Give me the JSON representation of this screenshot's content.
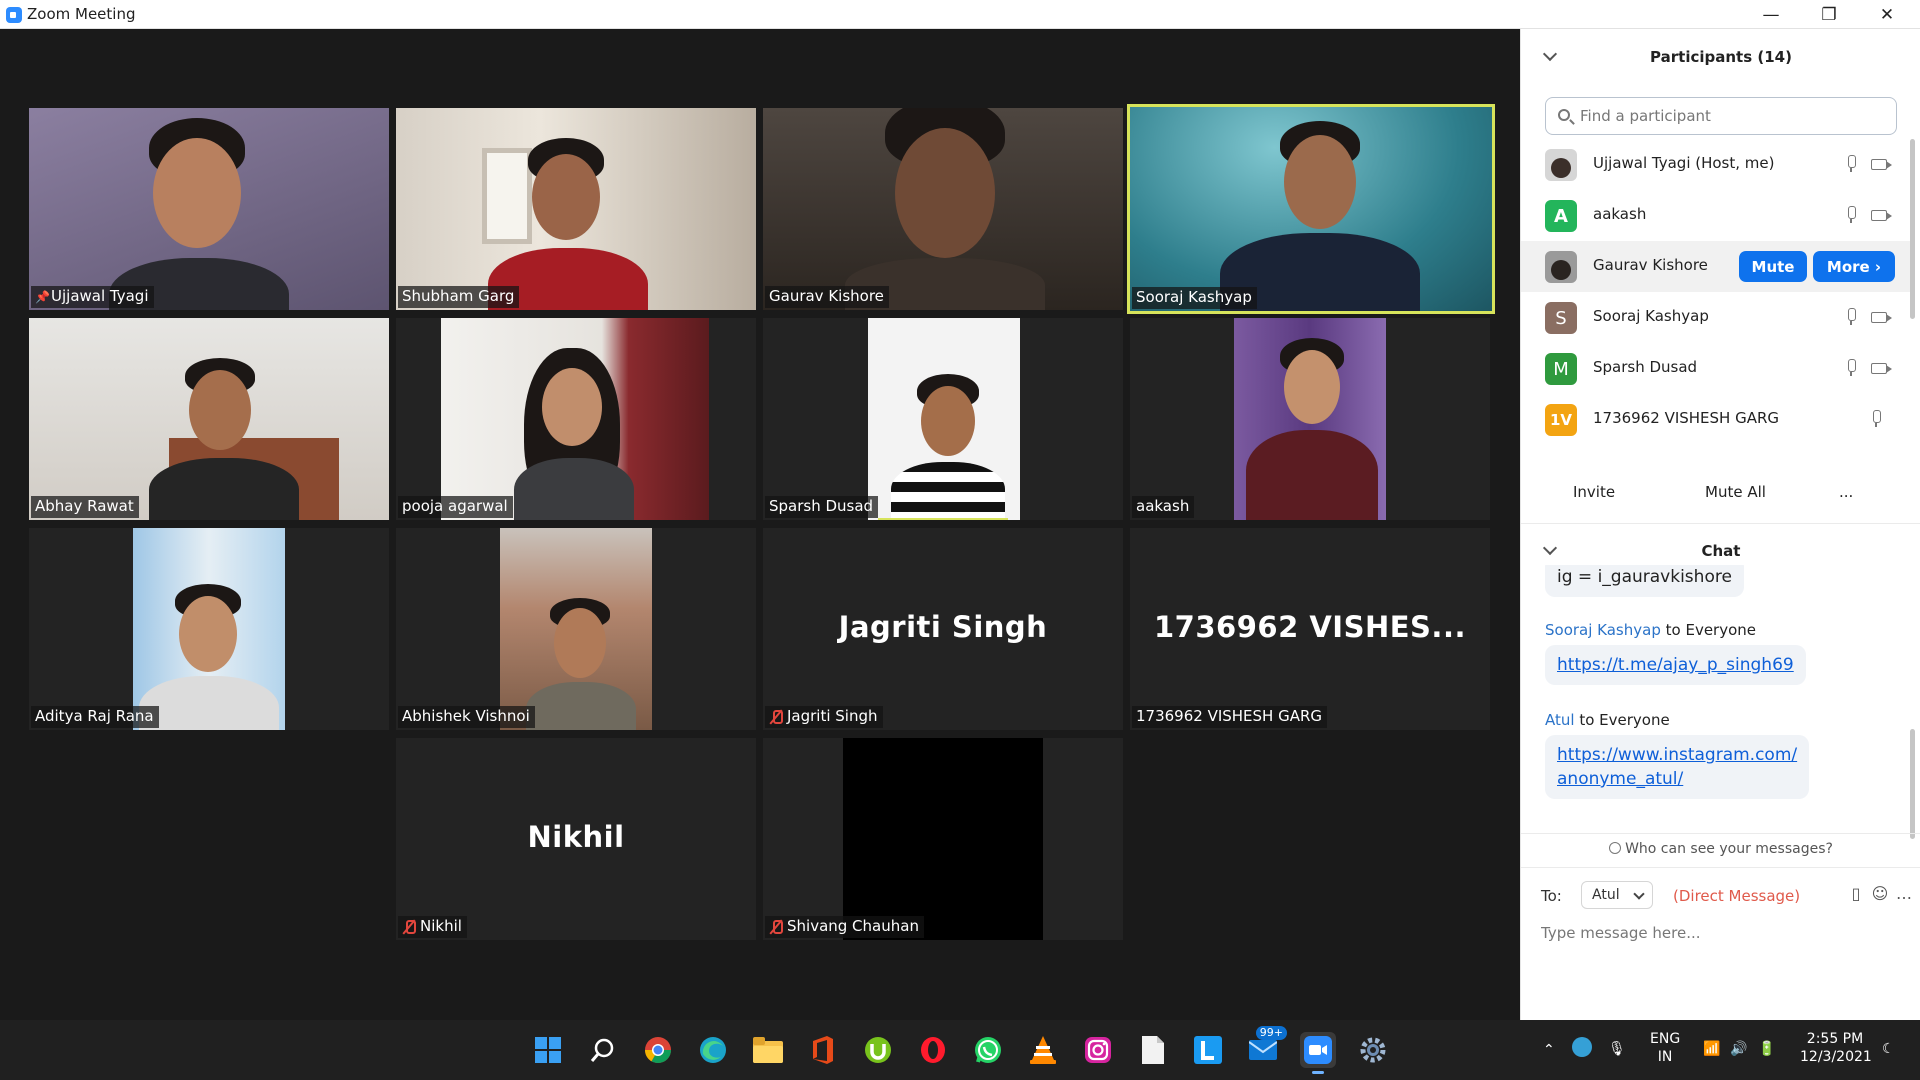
{
  "window": {
    "title": "Zoom Meeting",
    "controls": {
      "minimize": "—",
      "restore": "❐",
      "close": "✕"
    }
  },
  "gallery": {
    "tiles": [
      {
        "name": "Ujjawal Tyagi",
        "pinned": true,
        "video": true,
        "muted": false
      },
      {
        "name": "Shubham Garg",
        "video": true,
        "muted": false
      },
      {
        "name": "Gaurav Kishore",
        "video": true,
        "muted": false
      },
      {
        "name": "Sooraj Kashyap",
        "video": true,
        "muted": false,
        "active_speaker": true
      },
      {
        "name": "Abhay Rawat",
        "video": true,
        "muted": false
      },
      {
        "name": "pooja agarwal",
        "video": true,
        "muted": false
      },
      {
        "name": "Sparsh Dusad",
        "video": true,
        "muted": false
      },
      {
        "name": "aakash",
        "video": true,
        "muted": false
      },
      {
        "name": "Aditya Raj Rana",
        "video": true,
        "muted": false
      },
      {
        "name": "Abhishek Vishnoi",
        "video": true,
        "muted": false
      },
      {
        "name": "Jagriti Singh",
        "display_name": "Jagriti Singh",
        "video": false,
        "muted": true
      },
      {
        "name": "1736962 VISHESH GARG",
        "display_name": "1736962  VISHES...",
        "video": false,
        "muted": false
      },
      {
        "name": "Nikhil",
        "display_name": "Nikhil",
        "video": false,
        "muted": true
      },
      {
        "name": "Shivang Chauhan",
        "video": true,
        "muted": true
      }
    ]
  },
  "participants": {
    "header": "Participants (14)",
    "search_placeholder": "Find a participant",
    "list": [
      {
        "name": "Ujjawal Tyagi (Host, me)",
        "avatar": "photo",
        "avatar_color": "#c9c9c9"
      },
      {
        "name": "aakash",
        "avatar": "A",
        "avatar_color": "#23b55b"
      },
      {
        "name": "Gaurav Kishore",
        "avatar": "photo",
        "avatar_color": "#8b8b8b"
      },
      {
        "name": "Sooraj Kashyap",
        "avatar": "S",
        "avatar_color": "#8a6e62"
      },
      {
        "name": "Sparsh Dusad",
        "avatar": "M",
        "avatar_color": "#2f9a3e"
      },
      {
        "name": "1736962 VISHESH GARG",
        "avatar": "1V",
        "avatar_color": "#f3a412"
      }
    ],
    "mute_label": "Mute",
    "more_label": "More ›",
    "invite_label": "Invite",
    "mute_all_label": "Mute All",
    "more_dots_label": "..."
  },
  "chat": {
    "header": "Chat",
    "messages": [
      {
        "sender": "",
        "to": "",
        "text": "ig = i_gauravkishore",
        "link": false
      },
      {
        "sender": "Sooraj Kashyap",
        "to": "to Everyone",
        "text": "https://t.me/ajay_p_singh69",
        "link": true
      },
      {
        "sender": "Atul",
        "to": "to Everyone",
        "text": "https://www.instagram.com/",
        "text2": "anonyme_atul/",
        "link": true
      }
    ],
    "who_can_see": "Who can see your messages?",
    "to_label": "To:",
    "to_value": "Atul",
    "direct_message": "(Direct Message)",
    "placeholder": "Type message here..."
  },
  "taskbar": {
    "apps": [
      "windows-start-icon",
      "search-icon",
      "chrome-icon",
      "edge-icon",
      "file-explorer-icon",
      "office-icon",
      "utorrent-icon",
      "opera-icon",
      "whatsapp-icon",
      "vlc-icon",
      "instagram-icon",
      "notepad-icon",
      "lens-icon",
      "mail-icon",
      "zoom-icon",
      "settings-icon"
    ],
    "badge": "99+",
    "language_line1": "ENG",
    "language_line2": "IN",
    "time": "2:55 PM",
    "date": "12/3/2021"
  },
  "colors": {
    "accent": "#0e72ed",
    "active_speaker_border": "#d7e45b",
    "muted_red": "#e2463d",
    "link": "#0e5fd8"
  }
}
